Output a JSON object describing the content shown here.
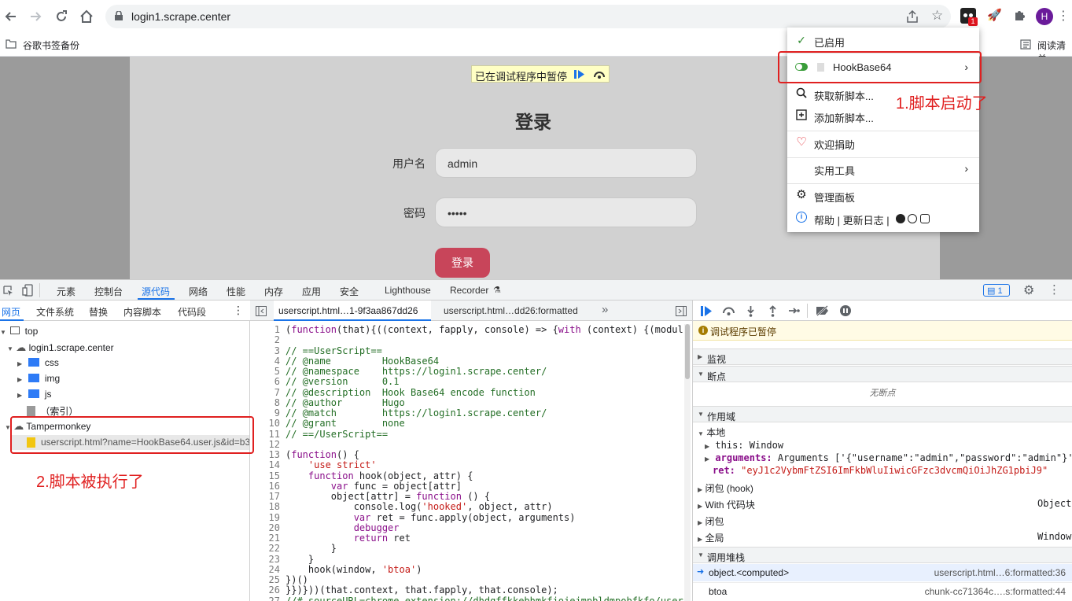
{
  "browser": {
    "url": "login1.scrape.center",
    "bookmark": "谷歌书签备份",
    "reading_list": "阅读清单",
    "profile_initial": "H",
    "ext_badge": "1"
  },
  "page": {
    "paused_text": "已在调试程序中暂停",
    "title": "登录",
    "username_label": "用户名",
    "username_value": "admin",
    "password_label": "密码",
    "password_value": "•••••",
    "login_button": "登录"
  },
  "tampermonkey_menu": {
    "enabled": "已启用",
    "script_name": "HookBase64",
    "get_scripts": "获取新脚本...",
    "add_script": "添加新脚本...",
    "donate": "欢迎捐助",
    "utilities": "实用工具",
    "dashboard": "管理面板",
    "help": "帮助 | 更新日志 |"
  },
  "annotations": {
    "a1": "1.脚本启动了",
    "a2": "2.脚本被执行了"
  },
  "devtools": {
    "tabs": [
      "元素",
      "控制台",
      "源代码",
      "网络",
      "性能",
      "内存",
      "应用",
      "安全",
      "Lighthouse",
      "Recorder"
    ],
    "active_tab": "源代码",
    "issues_count": "1",
    "nav_tabs": [
      "网页",
      "文件系统",
      "替换",
      "内容脚本",
      "代码段"
    ],
    "tree": {
      "top": "top",
      "domain": "login1.scrape.center",
      "css": "css",
      "img": "img",
      "js": "js",
      "index": "（索引）",
      "tampermonkey": "Tampermonkey",
      "userscript": "userscript.html?name=HookBase64.user.js&id=b3"
    },
    "editor_tabs": [
      "userscript.html…1-9f3aa867dd26",
      "userscript.html…dd26:formatted"
    ],
    "code_lines": [
      "(function(that){((context, fapply, console) => {with (context) {(modul",
      "",
      "// ==UserScript==",
      "// @name         HookBase64",
      "// @namespace    https://login1.scrape.center/",
      "// @version      0.1",
      "// @description  Hook Base64 encode function",
      "// @author       Hugo",
      "// @match        https://login1.scrape.center/",
      "// @grant        none",
      "// ==/UserScript==",
      "",
      "(function() {",
      "    'use strict'",
      "    function hook(object, attr) {",
      "        var func = object[attr]",
      "        object[attr] = function () {",
      "            console.log('hooked', object, attr)",
      "            var ret = func.apply(object, arguments)",
      "            debugger",
      "            return ret",
      "        }",
      "    }",
      "    hook(window, 'btoa')",
      "})()",
      "}})}))(that.context, that.fapply, that.console);",
      "//# sourceURL=chrome-extension://dhdgffkkebhmkfjojejmpbldmpobfkfo/user"
    ],
    "debugger": {
      "paused": "调试程序已暂停",
      "watch": "监视",
      "breakpoints": "断点",
      "no_breakpoints": "无断点",
      "scope": "作用域",
      "local": "本地",
      "this_label": "this: ",
      "this_value": "Window",
      "arguments_label": "arguments: ",
      "arguments_value": "Arguments ['{\"username\":\"admin\",\"password\":\"admin\"}',",
      "ret_label": "ret: ",
      "ret_value": "\"eyJ1c2VybmFtZSI6ImFkbWluIiwicGFzc3dvcmQiOiJhZG1pbiJ9\"",
      "closure_hook": "闭包 (hook)",
      "with_block": "With 代码块",
      "with_value": "Object",
      "closure": "闭包",
      "global": "全局",
      "global_value": "Window",
      "callstack": "调用堆栈",
      "frames": [
        {
          "name": "object.<computed>",
          "loc": "userscript.html…6:formatted:36"
        },
        {
          "name": "btoa",
          "loc": "chunk-cc71364c….s:formatted:44"
        }
      ]
    }
  }
}
